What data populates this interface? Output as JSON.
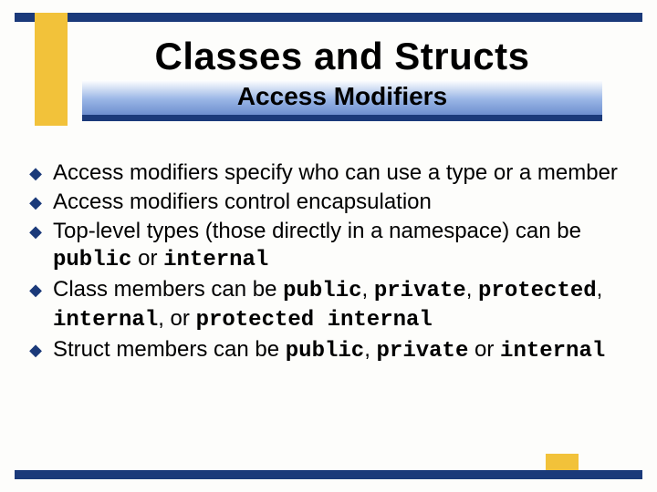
{
  "header": {
    "title": "Classes and Structs",
    "subtitle": "Access Modifiers"
  },
  "bullets": [
    {
      "html": "Access modifiers specify who can use a type or a member"
    },
    {
      "html": "Access modifiers control encapsulation"
    },
    {
      "html": "Top-level types (those directly in a namespace) can be <code>public</code> or <code>internal</code>"
    },
    {
      "html": "Class members can be <code>public</code>, <code>private</code>, <code>protected</code>, <code>internal</code>, or <code>protected internal</code>"
    },
    {
      "html": "Struct members can be <code>public</code>, <code>private</code> or <code>internal</code>"
    }
  ],
  "colors": {
    "accent_blue": "#1b3a7a",
    "accent_yellow": "#f2c23a"
  }
}
